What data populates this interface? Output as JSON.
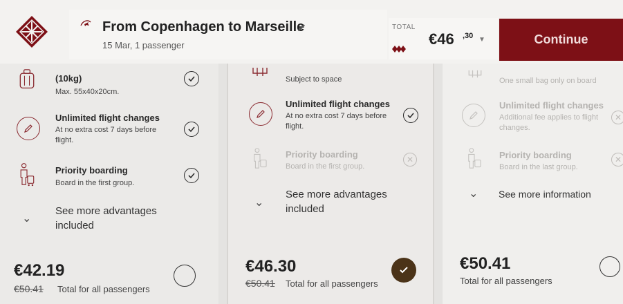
{
  "header": {
    "route_title": "From Copenhagen to Marseille",
    "route_subtitle": "15 Mar, 1 passenger",
    "total_label": "TOTAL",
    "total_price": "€46",
    "total_cents": ",30",
    "continue_label": "Continue"
  },
  "fares": [
    {
      "bag_title": "(10kg)",
      "bag_sub": "Max. 55x40x20cm.",
      "flex_title": "Unlimited flight changes",
      "flex_sub": "At no extra cost 7 days before flight.",
      "priority_title": "Priority boarding",
      "priority_sub": "Board in the first group.",
      "see_more": "See more advantages included",
      "price": "€42.19",
      "old_price": "€50.41",
      "price_note": "Total for all passengers",
      "selected": false
    },
    {
      "bag_sub": "Subject to space",
      "flex_title": "Unlimited flight changes",
      "flex_sub": "At no extra cost 7 days before flight.",
      "priority_title": "Priority boarding",
      "priority_sub": "Board in the first group.",
      "see_more": "See more advantages included",
      "price": "€46.30",
      "old_price": "€50.41",
      "price_note": "Total for all passengers",
      "selected": true
    },
    {
      "bag_sub": "One small bag only on board",
      "flex_title": "Unlimited flight changes",
      "flex_sub": "Additional fee applies to flight changes.",
      "priority_title": "Priority boarding",
      "priority_sub": "Board in the last group.",
      "see_more": "See more information",
      "price": "€50.41",
      "price_note": "Total for all passengers",
      "selected": false
    }
  ],
  "colors": {
    "brand": "#7d1016",
    "selected_radio": "#4b3318"
  }
}
